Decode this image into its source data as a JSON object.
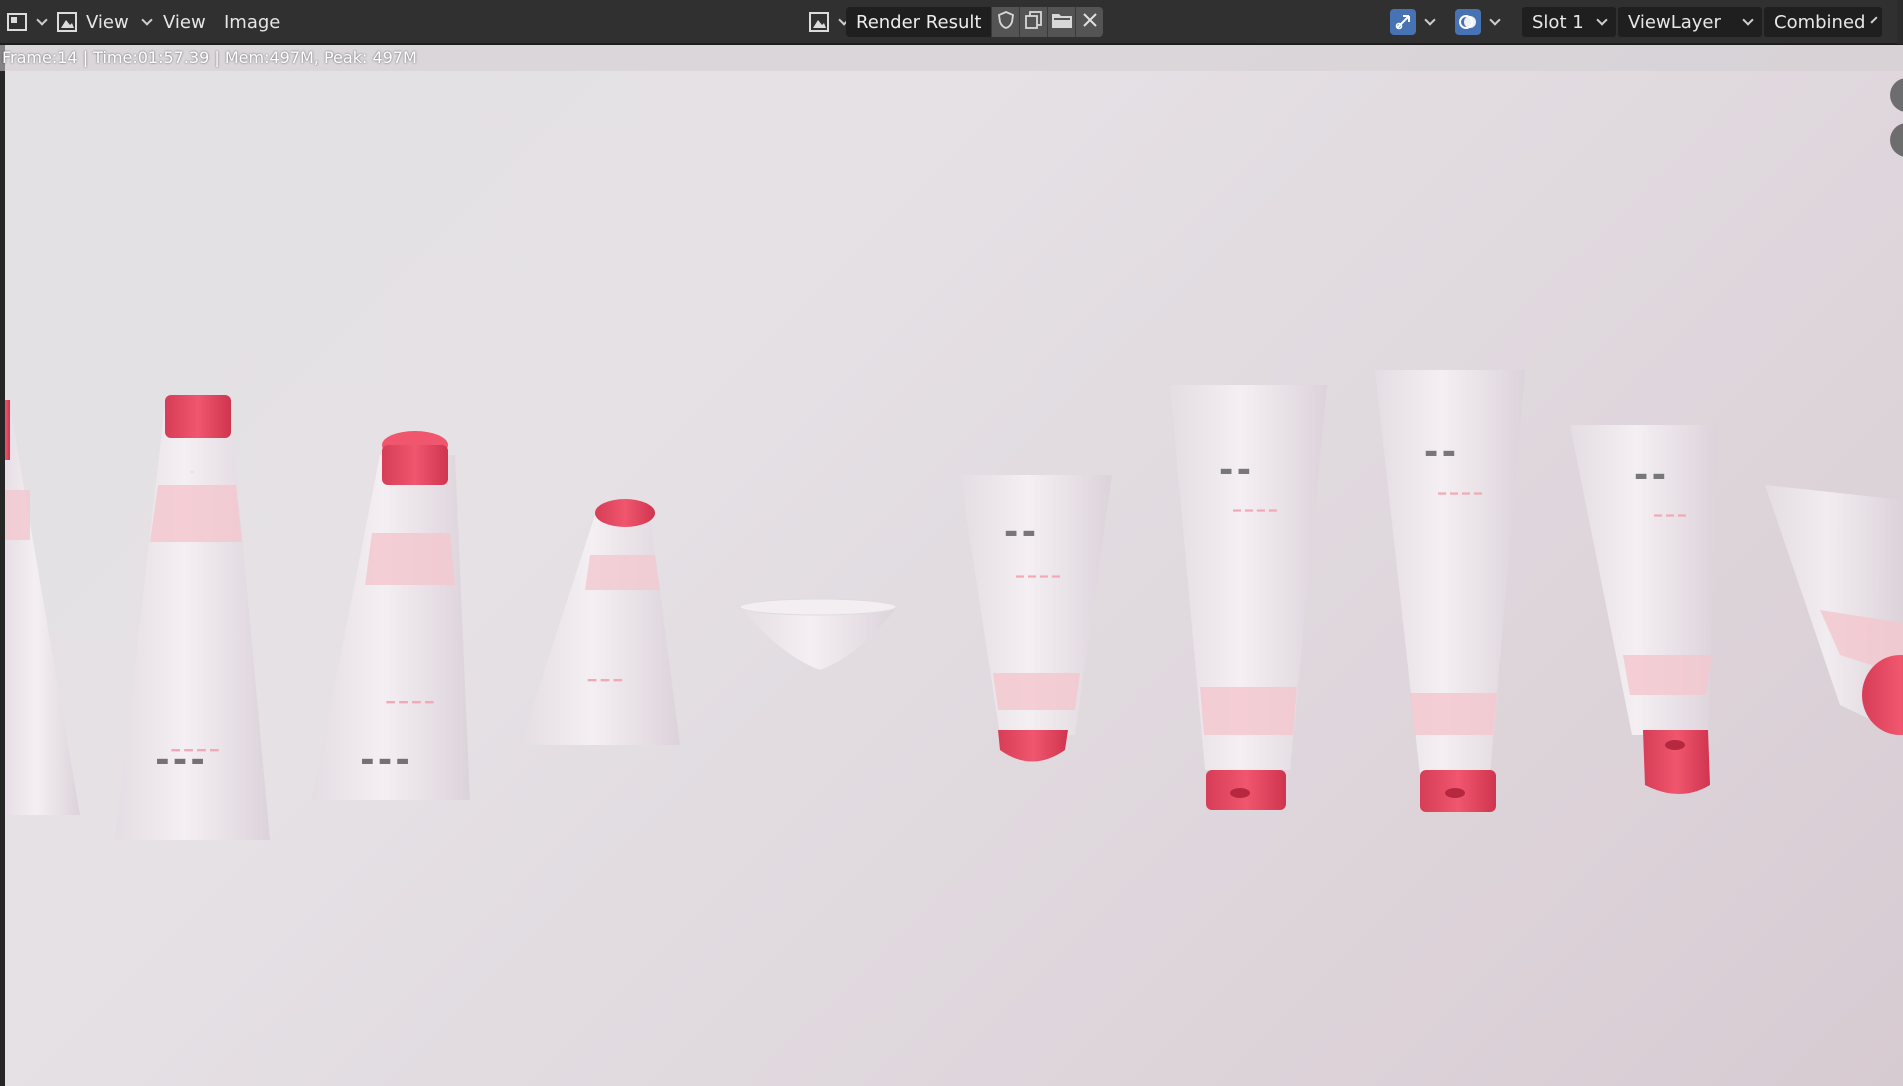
{
  "header": {
    "editor_type_icon": "image-editor-icon",
    "view_mode_label": "View",
    "menu": [
      "View",
      "Image"
    ],
    "image_name": "Render Result",
    "slot": "Slot 1",
    "view_layer": "ViewLayer",
    "pass": "Combined"
  },
  "status": {
    "stats": "Frame:14 | Time:01:57.39 | Mem:497M, Peak: 497M"
  },
  "icons": {
    "fake_user": "shield-icon",
    "duplicate": "duplicate-icon",
    "open": "folder-icon",
    "unlink": "close-icon",
    "gizmo": "gizmo-icon",
    "overlay": "overlay-icon"
  },
  "colors": {
    "header_bg": "#303030",
    "field_bg": "#1f1f1f",
    "accent_blue": "#4772b3",
    "cap_pink": "#e8475f"
  }
}
